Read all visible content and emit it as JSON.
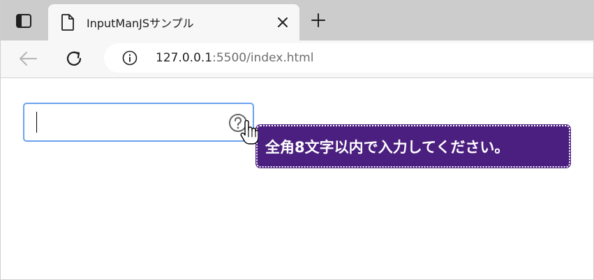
{
  "tab": {
    "title": "InputManJSサンプル"
  },
  "address_bar": {
    "url_host": "127.0.0.1",
    "url_rest": ":5500/index.html"
  },
  "page": {
    "input_value": "",
    "tooltip_text": "全角8文字以内で入力してください。"
  },
  "icons": {
    "tab_actions": "tab-actions-icon",
    "tab_file": "file-icon",
    "tab_close": "close-icon",
    "new_tab": "plus-icon",
    "back": "back-arrow-icon",
    "reload": "reload-icon",
    "site_info": "info-icon",
    "help": "question-circle-icon",
    "cursor": "hand-pointer-cursor-icon"
  },
  "colors": {
    "tab_strip": "#cccccc",
    "toolbar": "#f7f7f7",
    "input_focus_border": "#6aa2ee",
    "tooltip_background": "#4b1f7f",
    "tooltip_text": "#ffffff"
  }
}
